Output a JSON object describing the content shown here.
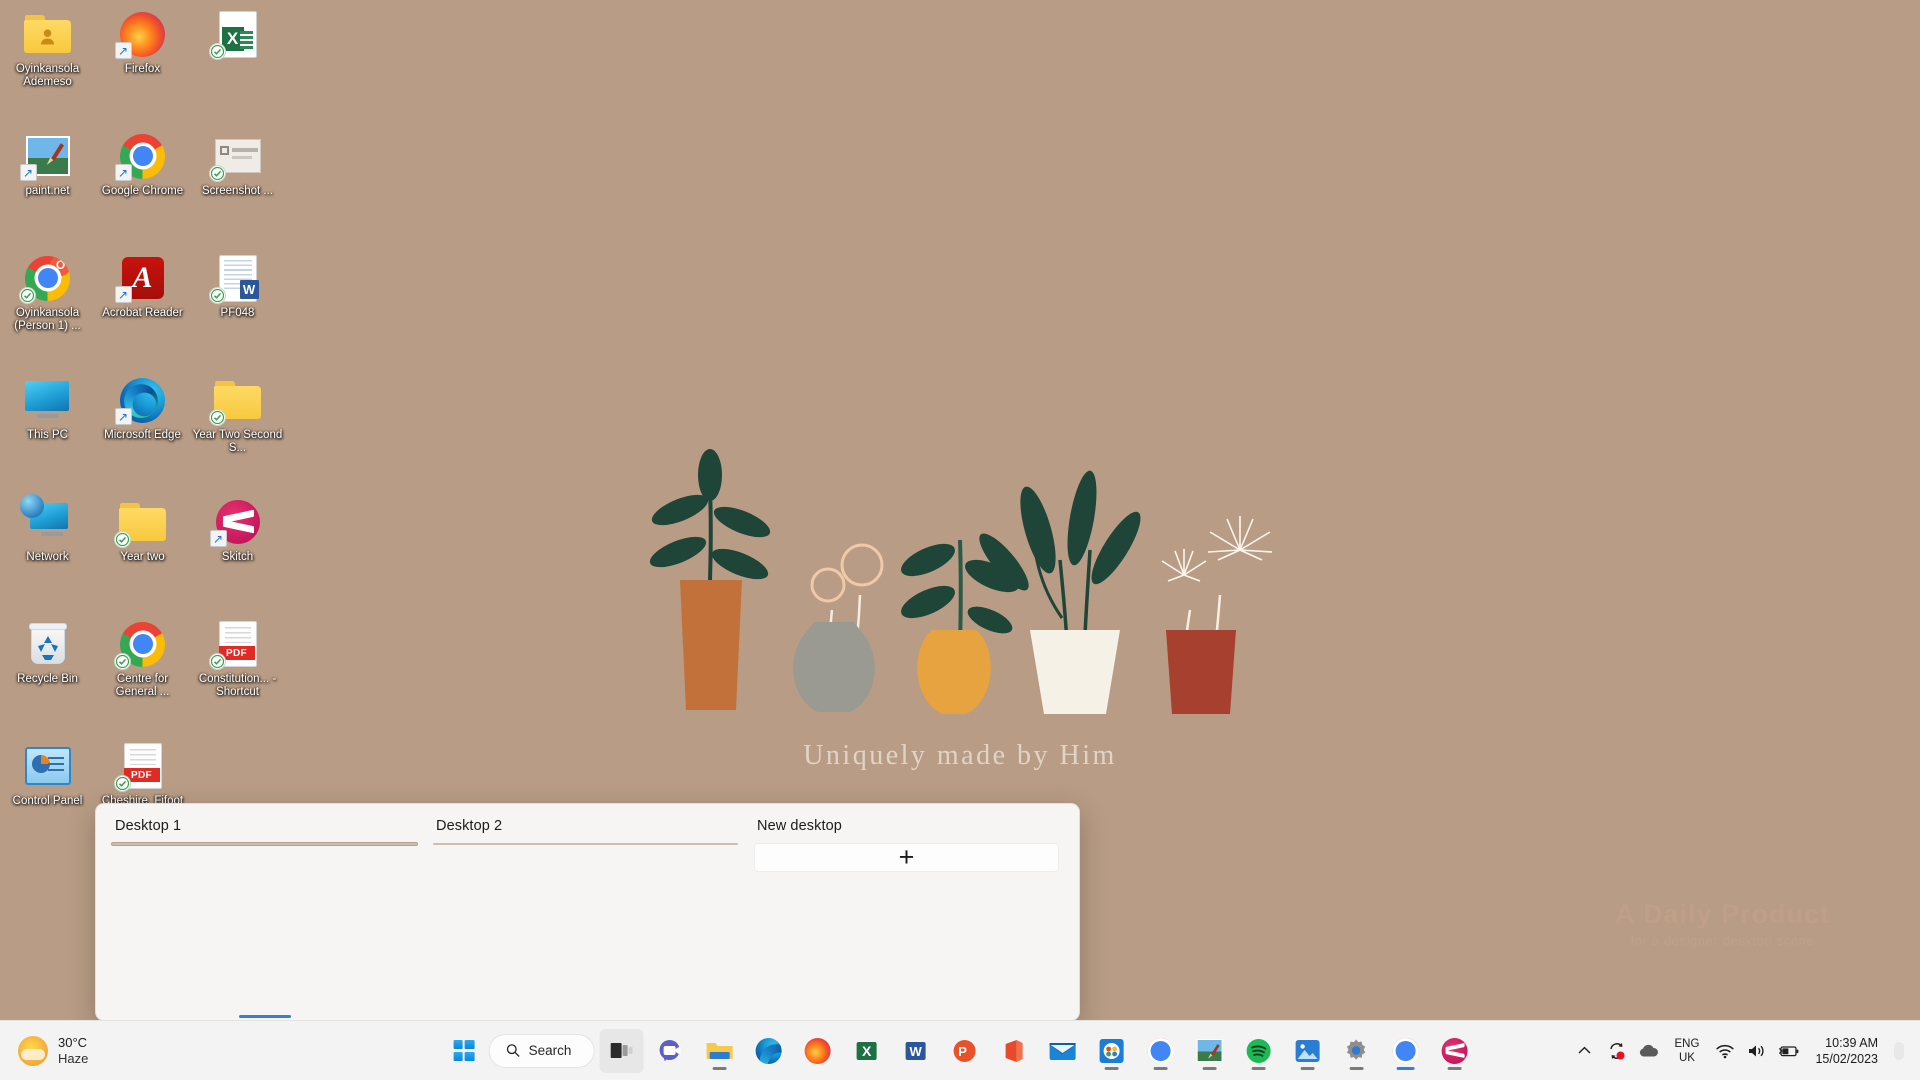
{
  "wallpaper": {
    "background_color": "#b89c85",
    "caption": "Uniquely made by Him",
    "watermark_title": "A Daily Product",
    "watermark_sub": "for a designer desktop scene"
  },
  "desktop_icons": [
    {
      "label": "Oyinkansola Ademeso",
      "icon": "user-folder-icon",
      "badge": "none"
    },
    {
      "label": "paint.net",
      "icon": "paintnet-icon",
      "badge": "shortcut"
    },
    {
      "label": "Oyinkansola (Person 1) ...",
      "icon": "chrome-profile-icon",
      "badge": "check"
    },
    {
      "label": "This PC",
      "icon": "this-pc-icon",
      "badge": "none"
    },
    {
      "label": "Network",
      "icon": "network-icon",
      "badge": "none"
    },
    {
      "label": "Recycle Bin",
      "icon": "recycle-bin-icon",
      "badge": "none"
    },
    {
      "label": "Control Panel",
      "icon": "control-panel-icon",
      "badge": "none"
    },
    {
      "label": "Firefox",
      "icon": "firefox-icon",
      "badge": "shortcut"
    },
    {
      "label": "Google Chrome",
      "icon": "chrome-icon",
      "badge": "shortcut"
    },
    {
      "label": "Acrobat Reader",
      "icon": "acrobat-reader-icon",
      "badge": "shortcut"
    },
    {
      "label": "Microsoft Edge",
      "icon": "edge-icon",
      "badge": "shortcut"
    },
    {
      "label": "Year two",
      "icon": "folder-icon",
      "badge": "check"
    },
    {
      "label": "Centre for General ...",
      "icon": "chrome-icon",
      "badge": "check"
    },
    {
      "label": "Cheshire, Fifoot and F...",
      "icon": "pdf-file-icon",
      "badge": "check"
    },
    {
      "label": "Screenshot ...",
      "icon": "screenshot-file-icon",
      "badge": "check"
    },
    {
      "label": "PF048",
      "icon": "word-file-icon",
      "badge": "check"
    },
    {
      "label": "Year Two Second S...",
      "icon": "folder-icon",
      "badge": "check"
    },
    {
      "label": "Skitch",
      "icon": "skitch-icon",
      "badge": "shortcut"
    },
    {
      "label": "Constitution... - Shortcut",
      "icon": "pdf-file-icon",
      "badge": "check"
    },
    {
      "label": "",
      "icon": "excel-file-icon",
      "badge": "check"
    }
  ],
  "taskview": {
    "desktops": [
      {
        "name": "Desktop 1",
        "state": "active",
        "thumbnail": "wallpaper-preview"
      },
      {
        "name": "Desktop 2",
        "state": "inactive",
        "thumbnail": "wallpaper-preview"
      },
      {
        "name": "New desktop",
        "state": "add",
        "thumbnail": "blank",
        "add_icon": "+"
      }
    ]
  },
  "taskbar": {
    "weather": {
      "temperature": "30°C",
      "condition": "Haze",
      "icon": "haze-sun-icon"
    },
    "start_label": "Start",
    "search": {
      "label": "Search",
      "icon": "search-icon"
    },
    "apps": [
      {
        "name": "task-view",
        "icon": "task-view-icon",
        "running": false,
        "active": true
      },
      {
        "name": "microsoft-teams",
        "icon": "teams-icon",
        "running": false,
        "active": false
      },
      {
        "name": "file-explorer",
        "icon": "file-explorer-icon",
        "running": true,
        "active": false
      },
      {
        "name": "microsoft-edge",
        "icon": "edge-icon",
        "running": false,
        "active": false
      },
      {
        "name": "firefox",
        "icon": "firefox-icon",
        "running": false,
        "active": false
      },
      {
        "name": "excel",
        "icon": "excel-icon",
        "running": false,
        "active": false
      },
      {
        "name": "word",
        "icon": "word-icon",
        "running": false,
        "active": false
      },
      {
        "name": "powerpoint",
        "icon": "powerpoint-icon",
        "running": false,
        "active": false
      },
      {
        "name": "office",
        "icon": "office-icon",
        "running": false,
        "active": false
      },
      {
        "name": "mail",
        "icon": "mail-icon",
        "running": false,
        "active": false
      },
      {
        "name": "widgets-board",
        "icon": "widgets-icon",
        "running": true,
        "active": false
      },
      {
        "name": "google-chrome",
        "icon": "chrome-icon",
        "running": true,
        "active": false
      },
      {
        "name": "paintnet",
        "icon": "paintnet-icon",
        "running": true,
        "active": false
      },
      {
        "name": "spotify",
        "icon": "spotify-icon",
        "running": true,
        "active": false
      },
      {
        "name": "photos",
        "icon": "photos-icon",
        "running": true,
        "active": false
      },
      {
        "name": "settings",
        "icon": "settings-gear-icon",
        "running": true,
        "active": false
      },
      {
        "name": "chrome-profile",
        "icon": "chrome-profile-icon",
        "running": true,
        "active": false
      },
      {
        "name": "skitch",
        "icon": "skitch-icon",
        "running": true,
        "active": false
      }
    ],
    "tray": {
      "overflow_icon": "chevron-up-icon",
      "sync_icon": "sync-alert-icon",
      "onedrive_icon": "cloud-icon",
      "language_line1": "ENG",
      "language_line2": "UK",
      "wifi_icon": "wifi-icon",
      "volume_icon": "speaker-icon",
      "battery_icon": "battery-charging-icon",
      "time": "10:39 AM",
      "date": "15/02/2023"
    }
  }
}
